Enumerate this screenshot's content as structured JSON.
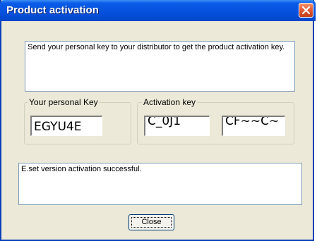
{
  "window": {
    "title": "Product activation"
  },
  "instructions": {
    "text": "Send your personal key to your distributor to get the product activation key."
  },
  "personal_key_group": {
    "label": "Your personal Key",
    "value": "EGYU4E"
  },
  "activation_key_group": {
    "label": "Activation key",
    "field1_value": "C_0J1",
    "field2_value": "CF~~C~"
  },
  "status": {
    "text": "E.set version activation successful."
  },
  "buttons": {
    "close_label": "Close"
  },
  "colors": {
    "titlebar": "#0550dc",
    "close_icon_bg": "#e1512b",
    "window_bg": "#ece9d8"
  },
  "icons": {
    "title_close": "close-icon"
  }
}
